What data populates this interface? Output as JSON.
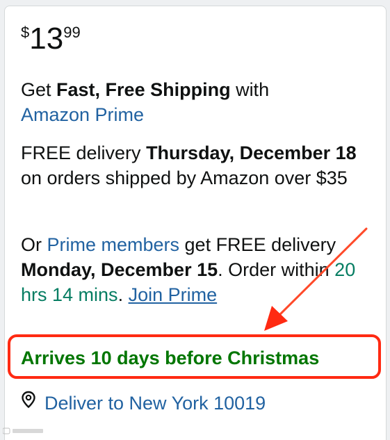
{
  "price": {
    "symbol": "$",
    "whole": "13",
    "fraction": "99"
  },
  "shipping": {
    "prefix": "Get ",
    "bold": "Fast, Free Shipping",
    "suffix": " with",
    "link": "Amazon Prime"
  },
  "delivery": {
    "prefix": "FREE delivery ",
    "bold_date": "Thursday, December 18",
    "suffix": " on orders shipped by Amazon over $35"
  },
  "prime_delivery": {
    "prefix": "Or ",
    "members_link": "Prime members",
    "mid": " get FREE delivery ",
    "bold_date": "Monday, December 15",
    "after_date": ". Order within ",
    "countdown": "20 hrs 14 mins",
    "after_countdown": ". ",
    "join_link": "Join Prime"
  },
  "christmas_banner": "Arrives 10 days before Christmas",
  "deliver_to": {
    "icon": "location-pin-icon",
    "label": "Deliver to New York 10019"
  },
  "colors": {
    "link": "#2162a1",
    "countdown": "#067d62",
    "banner_text": "#007600",
    "highlight_border": "#ff2a12"
  }
}
